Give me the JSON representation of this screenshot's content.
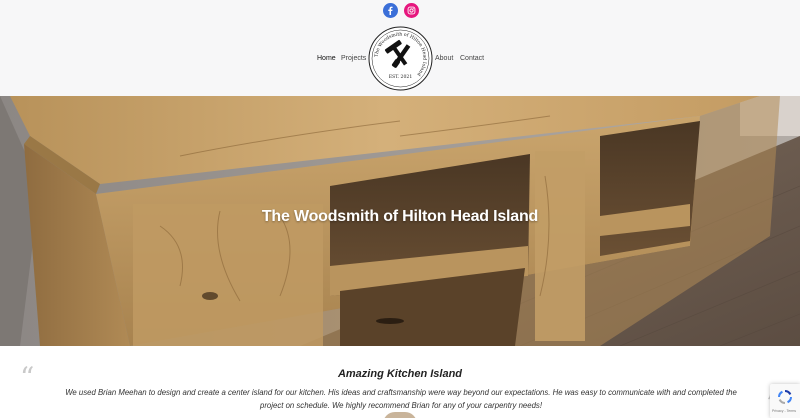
{
  "social": {
    "facebook": {
      "icon": "facebook-icon",
      "color": "#3b6fd8"
    },
    "instagram": {
      "icon": "instagram-icon",
      "color": "#e6177e"
    }
  },
  "nav": {
    "home": "Home",
    "projects": "Projects",
    "about": "About",
    "contact": "Contact"
  },
  "logo": {
    "ring_text": "The Woodsmith of Hilton Head Island",
    "est": "EST. 2021",
    "icon": "hammer-saw-icon"
  },
  "hero": {
    "title": "The Woodsmith of Hilton Head Island"
  },
  "testimonial": {
    "title": "Amazing Kitchen Island",
    "body": "We used Brian Meehan to design and create a center island for our kitchen. His ideas and craftsmanship were way beyond our expectations. He was easy to communicate with and completed the project on schedule. We highly recommend Brian for any of your carpentry needs!",
    "quote_open": "“",
    "quote_close": "”"
  },
  "recaptcha": {
    "text": "Privacy - Terms"
  },
  "colors": {
    "header_bg": "#f7f7f8",
    "wood": "#c9a56b",
    "floor": "#6f5e52"
  }
}
